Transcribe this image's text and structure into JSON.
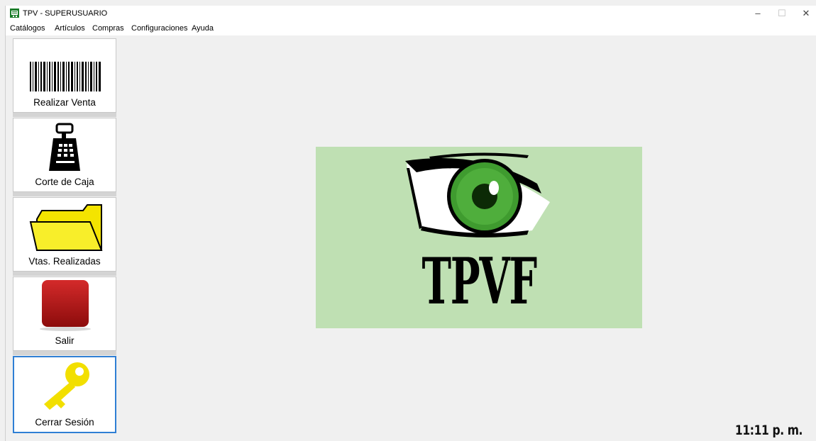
{
  "window": {
    "title": "TPV - SUPERUSUARIO",
    "controls": {
      "minimize": "–",
      "maximize": "☐",
      "close": "✕"
    }
  },
  "menu": [
    {
      "label": "Catálogos"
    },
    {
      "label": "Artículos"
    },
    {
      "label": "Compras"
    },
    {
      "label": "Configuraciones"
    },
    {
      "label": "Ayuda"
    }
  ],
  "sidebar": [
    {
      "label": "Realizar Venta",
      "icon": "barcode-icon"
    },
    {
      "label": "Corte de Caja",
      "icon": "cash-register-icon"
    },
    {
      "label": "Vtas. Realizadas",
      "icon": "folder-icon"
    },
    {
      "label": "Salir",
      "icon": "exit-button-icon"
    },
    {
      "label": "Cerrar Sesión",
      "icon": "key-icon",
      "active": true
    }
  ],
  "logo": {
    "text": "TPVF",
    "icon": "eye-logo"
  },
  "status": {
    "clock": "11:11 p. m."
  },
  "colors": {
    "accent": "#2f7fd4",
    "logo_bg": "#bfe0b3",
    "iris": "#3f9b2f",
    "folder": "#f4e400",
    "exit": "#b01414",
    "key": "#f2df00"
  }
}
